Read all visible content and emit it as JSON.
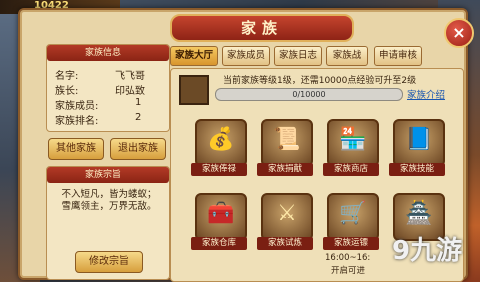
{
  "hud": {
    "gold": "10422"
  },
  "title": "家族",
  "close_label": "×",
  "info": {
    "header": "家族信息",
    "rows": [
      {
        "label": "名字:",
        "value": "飞飞哥"
      },
      {
        "label": "族长:",
        "value": "印弘致"
      },
      {
        "label": "家族成员:",
        "value": "1"
      },
      {
        "label": "家族排名:",
        "value": "2"
      }
    ]
  },
  "buttons": {
    "other_clans": "其他家族",
    "quit_clan": "退出家族",
    "edit_motto": "修改宗旨"
  },
  "motto": {
    "header": "家族宗旨",
    "text": "不入短凡，皆为蝼蚁；雪鹰领主，万界无敌。"
  },
  "tabs": [
    "家族大厅",
    "家族成员",
    "家族日志",
    "家族战",
    "申请审核"
  ],
  "level": {
    "text": "当前家族等级1级，还需10000点经验可升至2级",
    "current": 0,
    "max": 10000,
    "label": "0/10000",
    "intro_link": "家族介绍"
  },
  "features": [
    {
      "label": "家族俸禄",
      "icon": "money-bag-icon",
      "glyph": "💰"
    },
    {
      "label": "家族捐献",
      "icon": "scroll-icon",
      "glyph": "📜"
    },
    {
      "label": "家族商店",
      "icon": "shop-icon",
      "glyph": "🏪"
    },
    {
      "label": "家族技能",
      "icon": "skill-book-icon",
      "glyph": "📘"
    },
    {
      "label": "家族仓库",
      "icon": "treasure-chest-icon",
      "glyph": "🧰"
    },
    {
      "label": "家族试炼",
      "icon": "crossed-swords-icon",
      "glyph": "⚔"
    },
    {
      "label": "家族运镖",
      "icon": "cart-icon",
      "glyph": "🛒"
    },
    {
      "label": "",
      "icon": "temple-icon",
      "glyph": "🏯"
    }
  ],
  "event_time": "16:00~16:",
  "event_status": "开启可进",
  "watermark": "9九游"
}
